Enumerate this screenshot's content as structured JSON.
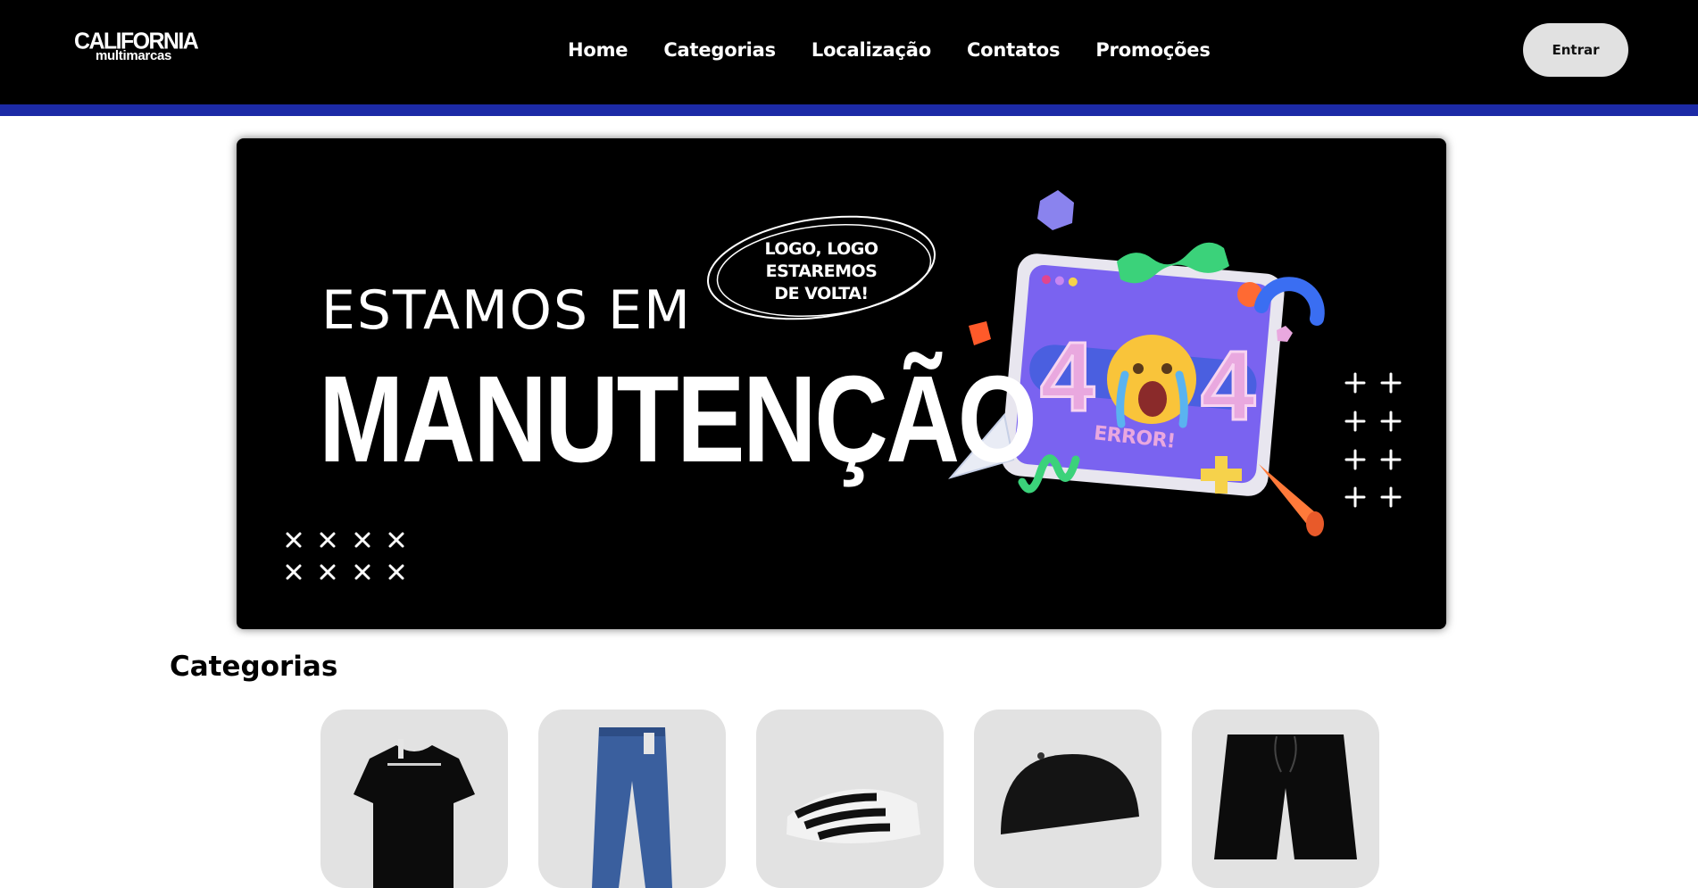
{
  "header": {
    "logo": {
      "top": "CALIFORNIA",
      "bottom": "multimarcas"
    },
    "nav": [
      "Home",
      "Categorias",
      "Localização",
      "Contatos",
      "Promoções"
    ],
    "login_label": "Entrar"
  },
  "banner": {
    "subtitle": "ESTAMOS EM",
    "title": "MANUTENÇÃO",
    "bubble_lines": [
      "LOGO, LOGO",
      "ESTAREMOS",
      "DE VOLTA!"
    ],
    "error_code": "404",
    "error_label": "ERROR!",
    "colors": {
      "background": "#000000",
      "screen": "#7a63f0",
      "accent_green": "#3bd27a",
      "accent_blue": "#3a6ef2",
      "accent_orange": "#ff6a33"
    }
  },
  "categories": {
    "title": "Categorias",
    "items": [
      {
        "icon": "tshirt-icon"
      },
      {
        "icon": "jeans-icon"
      },
      {
        "icon": "sneaker-icon"
      },
      {
        "icon": "cap-icon"
      },
      {
        "icon": "shorts-icon"
      }
    ]
  },
  "colors": {
    "header_bg": "#000000",
    "header_stripe": "#1c2aa6",
    "button_bg": "#e1e1e1",
    "card_bg": "#e2e2e2"
  }
}
